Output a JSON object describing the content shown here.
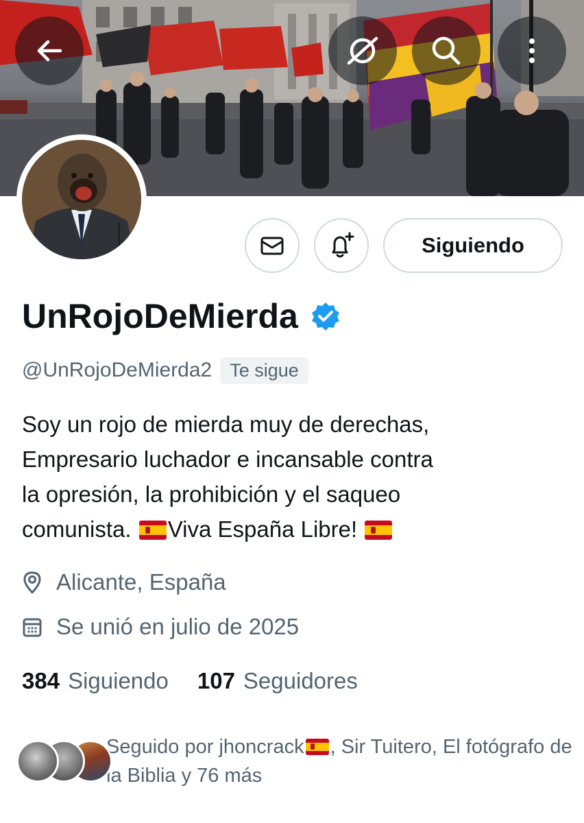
{
  "header": {
    "back_icon": "arrow-left-icon",
    "hide_icon": "eye-slash-icon",
    "search_icon": "search-icon",
    "more_icon": "more-vertical-icon"
  },
  "actions": {
    "message_icon": "envelope-icon",
    "notify_icon": "bell-plus-icon",
    "following_label": "Siguiendo"
  },
  "profile": {
    "display_name": "UnRojoDeMierda",
    "verified": true,
    "verified_color": "#1d9bf0",
    "handle": "@UnRojoDeMierda2",
    "follows_you": "Te sigue",
    "bio": {
      "line1": "Soy un rojo de mierda muy de derechas,",
      "line2": "Empresario luchador e incansable contra",
      "line3": "la opresión, la prohibición y el saqueo",
      "line4_start": "comunista. ",
      "line4_mid": "Viva España Libre! "
    },
    "location": "Alicante, España",
    "joined": "Se unió en julio de 2025"
  },
  "stats": {
    "following_count": "384",
    "following_label": "Siguiendo",
    "followers_count": "107",
    "followers_label": "Seguidores"
  },
  "followed_by": {
    "prefix": "Seguido por jhoncrack",
    "suffix": ", Sir Tuitero, El fotógrafo de la Biblia y 76 más"
  },
  "colors": {
    "text_primary": "#0f1419",
    "text_secondary": "#536471",
    "border": "#cfd9de",
    "badge_bg": "#eff3f4"
  }
}
